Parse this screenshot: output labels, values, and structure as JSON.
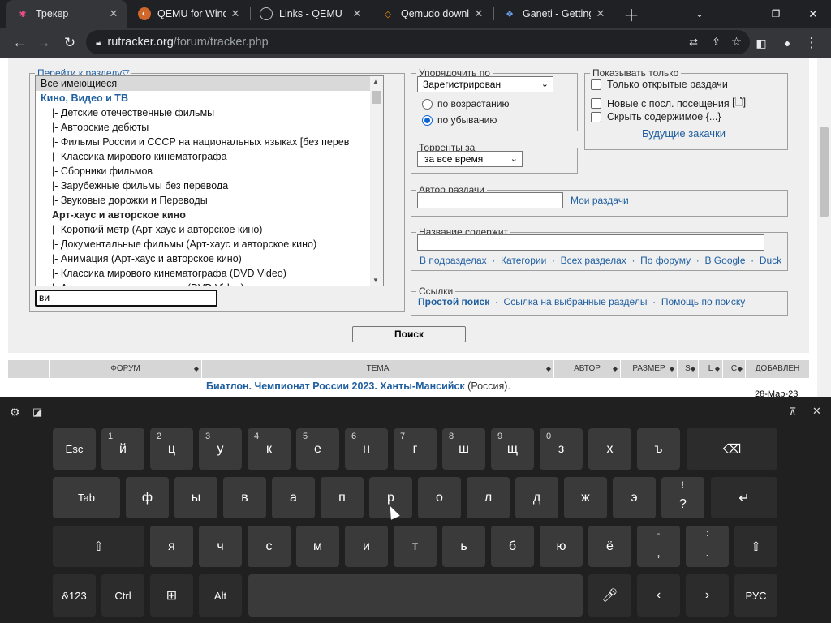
{
  "tabs": [
    {
      "title": "Трекер",
      "icon": "rutracker-icon",
      "active": true
    },
    {
      "title": "QEMU for Wind",
      "icon": "qemu-icon"
    },
    {
      "title": "Links - QEMU",
      "icon": "globe-icon"
    },
    {
      "title": "Qemudo downl",
      "icon": "qemudo-icon"
    },
    {
      "title": "Ganeti - Getting",
      "icon": "ganeti-icon"
    }
  ],
  "address": {
    "host": "rutracker.org",
    "path": "/forum/tracker.php"
  },
  "form": {
    "section_legend": "Перейти к разделу",
    "categories": [
      {
        "text": "Все имеющиеся",
        "kind": "sel"
      },
      {
        "text": "Кино, Видео и ТВ",
        "kind": "grp"
      },
      {
        "text": "|- Детские отечественные фильмы",
        "kind": "sub"
      },
      {
        "text": "|- Авторские дебюты",
        "kind": "sub"
      },
      {
        "text": "|- Фильмы России и СССР на национальных языках [без перев",
        "kind": "sub"
      },
      {
        "text": "|- Классика мирового кинематографа",
        "kind": "sub"
      },
      {
        "text": "|- Сборники фильмов",
        "kind": "sub"
      },
      {
        "text": "|- Зарубежные фильмы без перевода",
        "kind": "sub"
      },
      {
        "text": "|- Звуковые дорожки и Переводы",
        "kind": "sub"
      },
      {
        "text": "Арт-хаус и авторское кино",
        "kind": "grp2"
      },
      {
        "text": "|- Короткий метр (Арт-хаус и авторское кино)",
        "kind": "sub"
      },
      {
        "text": "|- Документальные фильмы (Арт-хаус и авторское кино)",
        "kind": "sub"
      },
      {
        "text": "|- Анимация (Арт-хаус и авторское кино)",
        "kind": "sub"
      },
      {
        "text": "|- Классика мирового кинематографа (DVD Video)",
        "kind": "sub"
      },
      {
        "text": "|- Арт-хаус и авторское кино (DVD Video)",
        "kind": "sub"
      }
    ],
    "filter_value": "ви",
    "sort_legend": "Упорядочить по",
    "sort_value": "Зарегистрирован",
    "sort_asc": "по возрастанию",
    "sort_desc": "по убыванию",
    "period_legend": "Торренты за",
    "period_value": "за все время",
    "show_legend": "Показывать только",
    "show_open": "Только открытые раздачи",
    "show_new": "Новые с посл. посещения",
    "show_new_icon": "[🗋]",
    "show_hide": "Скрыть содержимое",
    "show_hide_hint": "{...}",
    "future_downloads": "Будущие закачки",
    "author_legend": "Автор раздачи",
    "my_uploads": "Мои раздачи",
    "title_legend": "Название содержит",
    "title_links": [
      "В подразделах",
      "Категории",
      "Всех разделах",
      "По форуму",
      "В Google",
      "Duck"
    ],
    "links_legend": "Ссылки",
    "links_simple": "Простой поиск",
    "links_selected": "Ссылка на выбранные разделы",
    "links_help": "Помощь по поиску",
    "search_button": "Поиск"
  },
  "results": {
    "columns": [
      "ФОРУМ",
      "ТЕМА",
      "АВТОР",
      "РАЗМЕР",
      "S",
      "L",
      "C",
      "ДОБАВЛЕН"
    ],
    "row_topic": "Биатлон. Чемпионат России 2023. Ханты-Мансийск",
    "row_topic_suffix": "(Россия).",
    "row_date": "28-Мар-23"
  },
  "keyboard": {
    "row1": [
      [
        "Esc",
        ""
      ],
      [
        "й",
        "1"
      ],
      [
        "ц",
        "2"
      ],
      [
        "у",
        "3"
      ],
      [
        "к",
        "4"
      ],
      [
        "е",
        "5"
      ],
      [
        "н",
        "6"
      ],
      [
        "г",
        "7"
      ],
      [
        "ш",
        "8"
      ],
      [
        "щ",
        "9"
      ],
      [
        "з",
        "0"
      ],
      [
        "х",
        ""
      ],
      [
        "ъ",
        ""
      ]
    ],
    "row2": [
      "Tab",
      "ф",
      "ы",
      "в",
      "а",
      "п",
      "р",
      "о",
      "л",
      "д",
      "ж",
      "э"
    ],
    "row2_q": {
      "main": "?",
      "alt": "!"
    },
    "row3": [
      "я",
      "ч",
      "с",
      "м",
      "и",
      "т",
      "ь",
      "б",
      "ю",
      "ё"
    ],
    "row3_comma": {
      "main": ",",
      "alt": "-"
    },
    "row3_dot": {
      "main": ".",
      "alt": ":"
    },
    "bottom": {
      "sym": "&123",
      "ctrl": "Ctrl",
      "alt": "Alt",
      "lang": "РУС"
    }
  }
}
